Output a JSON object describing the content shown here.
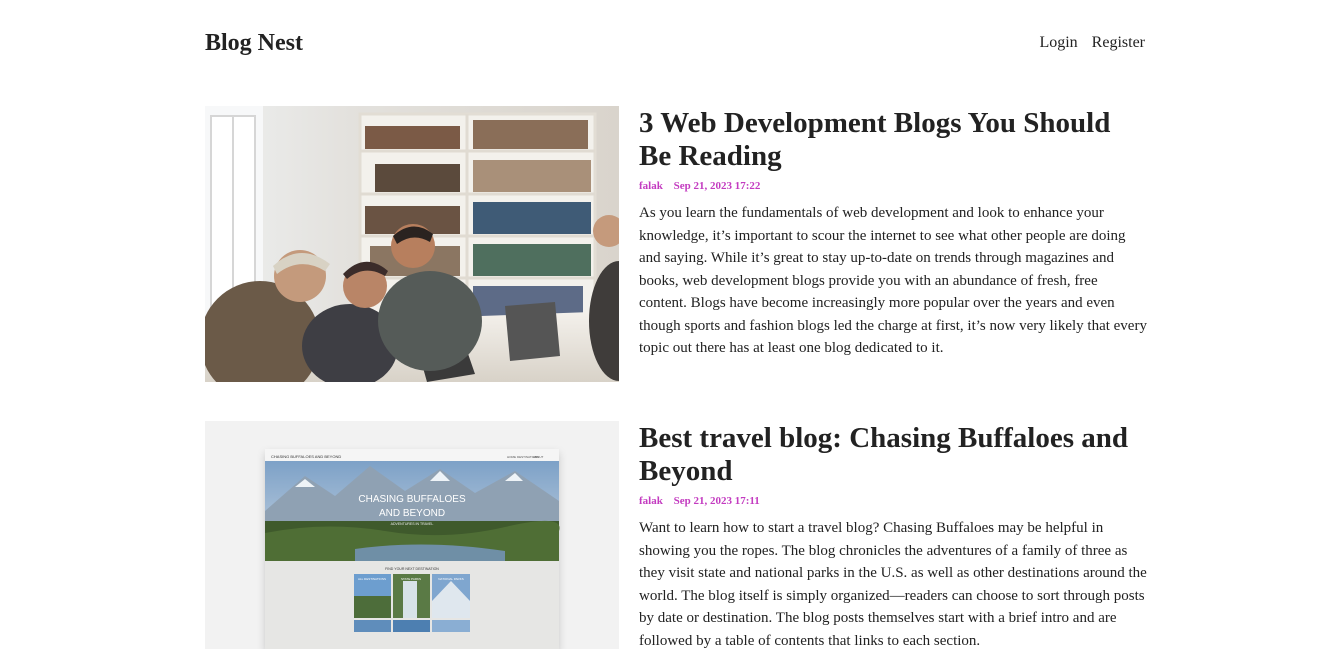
{
  "nav": {
    "brand": "Blog Nest",
    "login": "Login",
    "register": "Register"
  },
  "posts": [
    {
      "title": "3 Web Development Blogs You Should Be Reading",
      "author": "falak",
      "date": "Sep 21, 2023 17:22",
      "excerpt": "As you learn the fundamentals of web development and look to enhance your knowledge, it’s important to scour the internet to see what other people are doing and saying. While it’s great to stay up-to-date on trends through magazines and books, web development blogs provide you with an abundance of fresh, free content. Blogs have become increasingly more popular over the years and even though sports and fashion blogs led the charge at first, it’s now very likely that every topic out there has at least one blog dedicated to it."
    },
    {
      "title": "Best travel blog: Chasing Buffaloes and Beyond",
      "author": "falak",
      "date": "Sep 21, 2023 17:11",
      "excerpt": "Want to learn how to start a travel blog? Chasing Buffaloes may be helpful in showing you the ropes. The blog chronicles the adventures of a family of three as they visit state and national parks in the U.S. as well as other destinations around the world. The blog itself is simply organized—readers can choose to sort through posts by date or destination. The blog posts themselves start with a brief intro and are followed by a table of contents that links to each section."
    }
  ],
  "thumbnail_2": {
    "site_name": "CHASING BUFFALOES AND BEYOND",
    "nav_items": [
      "HOME",
      "DESTINATIONS",
      "ABOUT"
    ],
    "hero_title_1": "CHASING BUFFALOES",
    "hero_title_2": "AND BEYOND",
    "hero_sub": "ADVENTURES IN TRAVEL",
    "find_heading": "FIND YOUR NEXT DESTINATION",
    "tiles": [
      "ALL DESTINATIONS",
      "STATE PARKS",
      "NATIONAL PARKS"
    ]
  }
}
